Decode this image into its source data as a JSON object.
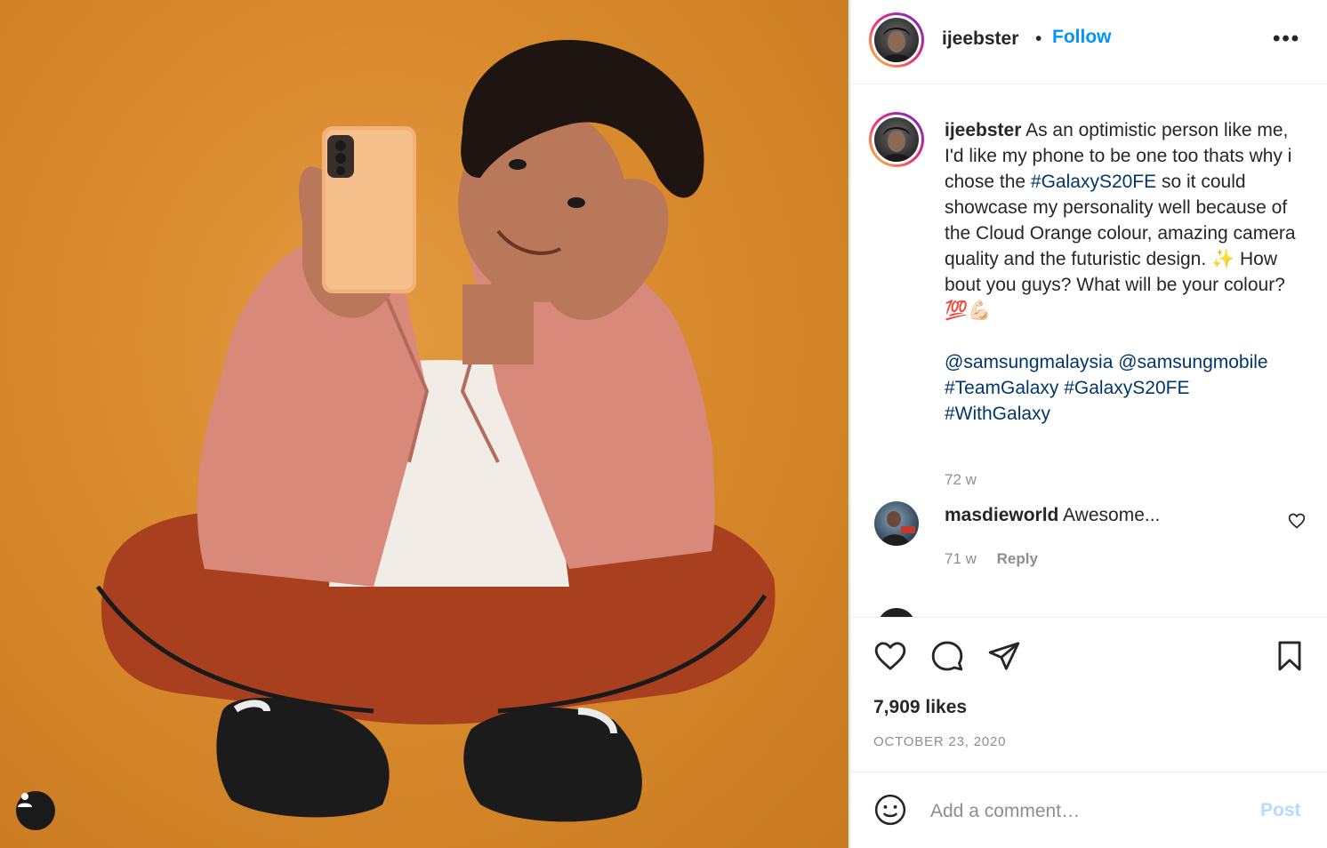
{
  "post": {
    "username": "ijeebster",
    "follow_label": "Follow",
    "separator": "•",
    "more_label": "•••",
    "caption": {
      "username": "ijeebster",
      "text_1": " As an optimistic person like me, I'd like my phone to be one too thats why i chose the ",
      "hashtag_1": "#GalaxyS20FE",
      "text_2": " so it could showcase my personality well because of the Cloud Orange colour, amazing camera quality and the futuristic design. ✨ How bout you guys? What will be your colour? 💯💪🏻",
      "mentions": "@samsungmalaysia @samsungmobile",
      "hashtags": "#TeamGalaxy #GalaxyS20FE",
      "hashtags_2": "#WithGalaxy",
      "time": "72 w"
    },
    "comments": [
      {
        "username": "masdieworld",
        "text": " Awesome...",
        "time": "71 w",
        "reply_label": "Reply"
      }
    ],
    "likes": "7,909 likes",
    "date": "OCTOBER 23, 2020",
    "comment_placeholder": "Add a comment…",
    "post_label": "Post"
  },
  "icons": {
    "like": "heart-icon",
    "comment": "comment-bubble-icon",
    "share": "paper-plane-icon",
    "save": "bookmark-icon",
    "emoji": "smiley-icon",
    "tag_user": "user-tag-icon"
  },
  "colors": {
    "accent": "#0095f6",
    "link": "#00376b",
    "muted": "#8e8e8e",
    "post_disabled": "#b3dbff",
    "photo_background": "#d98a2c"
  }
}
